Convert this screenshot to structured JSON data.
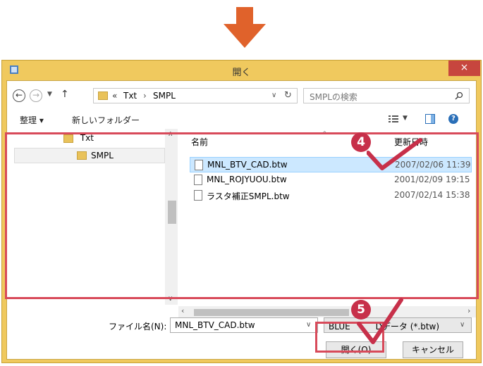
{
  "window": {
    "title": "開く",
    "close_glyph": "×"
  },
  "address": {
    "path_prefix": "«",
    "segments": [
      "Txt",
      "SMPL"
    ],
    "separator": "›",
    "search_placeholder": "SMPLの検索"
  },
  "toolbar": {
    "organize_label": "整理 ▾",
    "new_folder_label": "新しいフォルダー"
  },
  "tree": {
    "items": [
      {
        "label": "Txt"
      },
      {
        "label": "SMPL"
      }
    ]
  },
  "file_list": {
    "columns": {
      "name": "名前",
      "modified": "更新日時"
    },
    "rows": [
      {
        "name": "MNL_BTV_CAD.btw",
        "date": "2007/02/06 11:39"
      },
      {
        "name": "MNL_ROJYUOU.btw",
        "date": "2001/02/09 19:15"
      },
      {
        "name": "ラスタ補正SMPL.btw",
        "date": "2007/02/14 15:38"
      }
    ]
  },
  "bottom": {
    "filename_label": "ファイル名(N):",
    "filename_value": "MNL_BTV_CAD.btw",
    "filetype_value": "BLUE　　　Dデータ (*.btw)",
    "open_label": "開く(O)",
    "cancel_label": "キャンセル"
  },
  "annotations": {
    "badge_4": "4",
    "badge_5": "5"
  },
  "colors": {
    "accent": "#c7304a",
    "titlebar": "#f0c95e",
    "selection": "#cce8ff",
    "arrow": "#e0622b"
  }
}
